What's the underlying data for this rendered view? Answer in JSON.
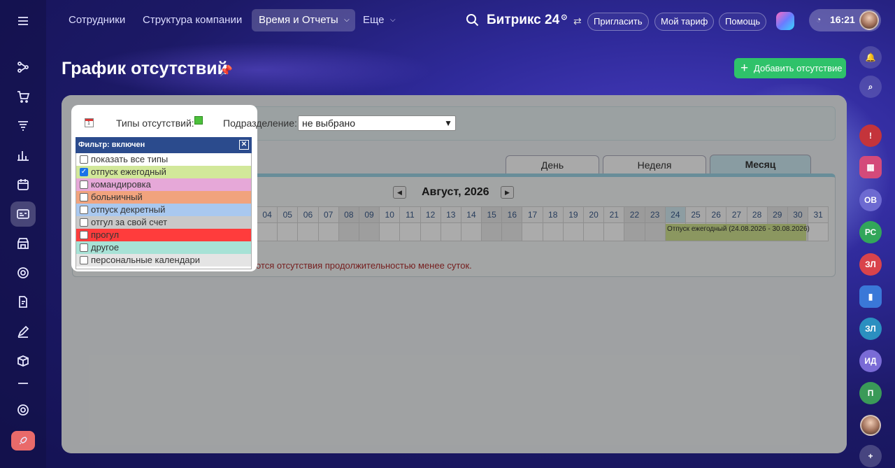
{
  "topnav": {
    "items": [
      "Сотрудники",
      "Структура компании",
      "Время и Отчеты",
      "Еще"
    ],
    "brand": "Битрикс",
    "brand_num": "24",
    "invite": "Пригласить",
    "tariff": "Мой тариф",
    "help": "Помощь",
    "time": "16:21"
  },
  "page": {
    "title": "График отсутствий",
    "add_button": "Добавить отсутствие"
  },
  "toolbar": {
    "types_label": "Типы отсутствий:",
    "dept_label": "Подразделение:",
    "dept_value": "не выбрано"
  },
  "tabs": [
    "День",
    "Неделя",
    "Месяц"
  ],
  "calendar": {
    "month": "Август, 2026",
    "days": [
      "04",
      "05",
      "06",
      "07",
      "08",
      "09",
      "10",
      "11",
      "12",
      "13",
      "14",
      "15",
      "16",
      "17",
      "18",
      "19",
      "20",
      "21",
      "22",
      "23",
      "24",
      "25",
      "26",
      "27",
      "28",
      "29",
      "30",
      "31"
    ],
    "event": "Отпуск ежегодный (24.08.2026 - 30.08.2026)",
    "note": "отся отсутствия продолжительностью менее суток."
  },
  "filter": {
    "header": "Фильтр: включен",
    "items": [
      {
        "label": "показать все типы",
        "checked": false,
        "color": "#ffffff"
      },
      {
        "label": "отпуск ежегодный",
        "checked": true,
        "color": "#d2e89a"
      },
      {
        "label": "командировка",
        "checked": false,
        "color": "#e6a8d8"
      },
      {
        "label": "больничный",
        "checked": false,
        "color": "#f1a37d"
      },
      {
        "label": "отпуск декретный",
        "checked": false,
        "color": "#a9c8ef"
      },
      {
        "label": "отгул за свой счет",
        "checked": false,
        "color": "#c9c9c9"
      },
      {
        "label": "прогул",
        "checked": false,
        "color": "#ff3c3c"
      },
      {
        "label": "другое",
        "checked": false,
        "color": "#a7e2d6"
      },
      {
        "label": "персональные календари",
        "checked": false,
        "color": "#e4e4e4"
      }
    ]
  },
  "right_rail": [
    "ОВ",
    "РС",
    "ЗЛ",
    "ЗЛ",
    "ИД",
    "П"
  ]
}
